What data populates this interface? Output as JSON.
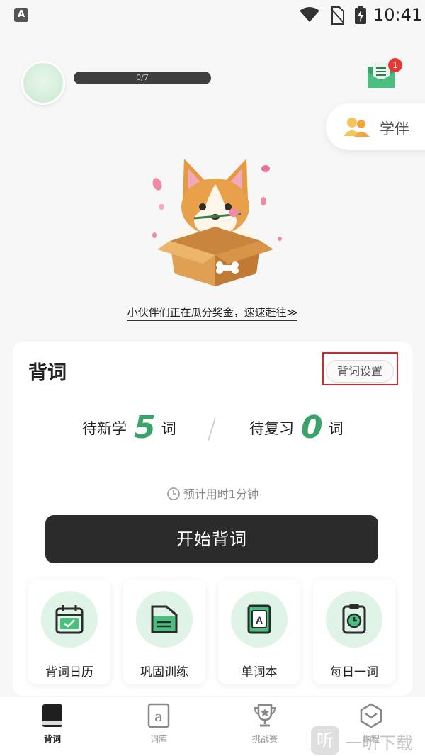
{
  "status_bar": {
    "app_icon_letter": "A",
    "time": "10:41"
  },
  "header": {
    "progress": {
      "text": "0/7",
      "done": 0,
      "total": 7
    },
    "mail": {
      "badge": "1"
    },
    "companion": {
      "label": "学伴"
    }
  },
  "promo": {
    "text": "小伙伴们正在瓜分奖金，速速赶往≫"
  },
  "card": {
    "title": "背词",
    "settings_label": "背词设置",
    "new_words": {
      "label": "待新学",
      "count": "5",
      "unit": "词"
    },
    "review_words": {
      "label": "待复习",
      "count": "0",
      "unit": "词"
    },
    "estimate": "预计用时1分钟",
    "start_label": "开始背词",
    "tiles": [
      {
        "label": "背词日历",
        "icon": "calendar-icon"
      },
      {
        "label": "巩固训练",
        "icon": "folder-icon"
      },
      {
        "label": "单词本",
        "icon": "wordbook-icon"
      },
      {
        "label": "每日一词",
        "icon": "daily-word-icon"
      }
    ]
  },
  "bottom_nav": {
    "items": [
      {
        "label": "背词",
        "icon": "book-icon",
        "active": true
      },
      {
        "label": "词库",
        "icon": "lexicon-icon",
        "active": false
      },
      {
        "label": "挑战赛",
        "icon": "trophy-icon",
        "active": false
      },
      {
        "label": "课程",
        "icon": "course-icon",
        "active": false
      }
    ]
  },
  "watermark": {
    "logo": "听",
    "text": "一听下载"
  },
  "colors": {
    "accent": "#3aa36a",
    "icon_bg": "#dff3e7",
    "dark_button": "#2b2b2b",
    "highlight": "#e0202a",
    "badge": "#e53935"
  }
}
